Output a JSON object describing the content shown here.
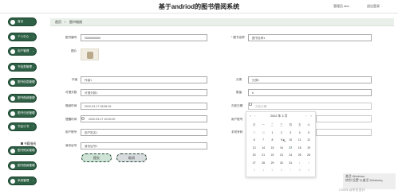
{
  "header": {
    "title": "基于andriod的图书借阅系统",
    "admin": "管理员 abo",
    "logout": "退出登录"
  },
  "sidebar": {
    "items": [
      {
        "label": "首页"
      },
      {
        "label": "个人中心"
      },
      {
        "label": "用户管理"
      },
      {
        "label": "书信类管理"
      },
      {
        "label": "图书信息管理"
      },
      {
        "label": "图书借阅管理"
      },
      {
        "label": "图书归还管理"
      },
      {
        "label": "书目订书"
      },
      {
        "label": "图书购买管理"
      },
      {
        "label": "图书借阅管理"
      },
      {
        "label": "系统管理"
      }
    ],
    "plain_item": "书籍借阅"
  },
  "breadcrumb": {
    "home": "首页",
    "separator": "/",
    "current": "图书借阅"
  },
  "form": {
    "book_no_label": "图书编号",
    "book_no_value": "0666666666",
    "book_name_label": "* 图书名称",
    "book_name_value": "图书名称1",
    "cover_label": "图片",
    "author_label": "作者",
    "author_value": "作者1",
    "category_label": "分类",
    "category_value": "分类1",
    "shelf_label": "可借天数",
    "shelf_value": "可借天数1",
    "quantity_label": "数量",
    "quantity_value": "6",
    "borrow_date_label": "借阅时间",
    "borrow_date_value": "2022-03-17 18:56:15",
    "return_date_label": "归还日期",
    "return_date_placeholder": "归还日期",
    "reminder_label": "提醒时间",
    "reminder_value": "2022-03-17 10:00:00",
    "account_label": "用户账号",
    "account_placeholder": "用户账号",
    "username_label": "用户姓名",
    "username_value": "用户姓名1",
    "phone_label": "手机号码",
    "phone_placeholder": "手机号码",
    "idcard_label": "身份证号",
    "idcard_value": "身份证号1"
  },
  "buttons": {
    "submit": "提交",
    "cancel": "取消"
  },
  "datepicker": {
    "prev_year": "«",
    "prev_month": "‹",
    "title": "2022 年  3 月",
    "next_month": "›",
    "next_year": "»",
    "weekdays": [
      "日",
      "一",
      "二",
      "三",
      "四",
      "五",
      "六"
    ],
    "weeks": [
      [
        "27",
        "28",
        "1",
        "2",
        "3",
        "4",
        "5"
      ],
      [
        "6",
        "7",
        "8",
        "9",
        "10",
        "11",
        "12"
      ],
      [
        "13",
        "14",
        "15",
        "16",
        "17",
        "18",
        "19"
      ],
      [
        "20",
        "21",
        "22",
        "23",
        "24",
        "25",
        "26"
      ],
      [
        "27",
        "28",
        "29",
        "30",
        "31",
        "1",
        "2"
      ],
      [
        "3",
        "4",
        "5",
        "6",
        "7",
        "8",
        "9"
      ]
    ]
  },
  "watermark": {
    "line1": "激活 Windows",
    "line2": "转到\"设置\"以激活 Windows。"
  },
  "csdn": "CSDN @毕业设计"
}
